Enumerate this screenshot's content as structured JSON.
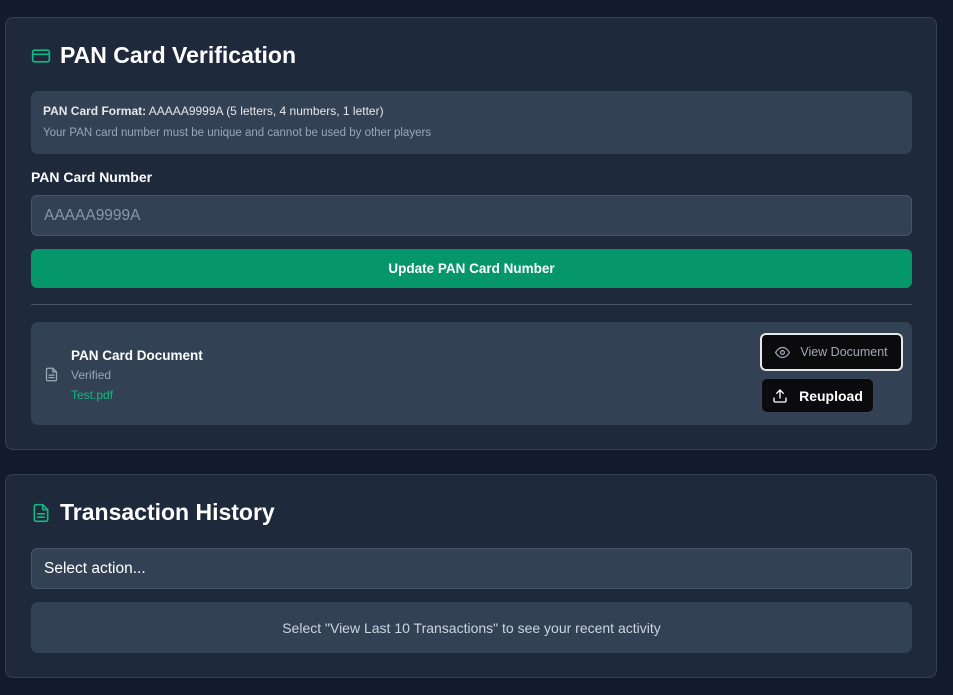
{
  "pan_section": {
    "title": "PAN Card Verification",
    "title_icon": "credit-card-icon",
    "info": {
      "format_label": "PAN Card Format:",
      "format_value": " AAAAA9999A (5 letters, 4 numbers, 1 letter)",
      "note": "Your PAN card number must be unique and cannot be used by other players"
    },
    "field_label": "PAN Card Number",
    "input_value": "",
    "input_placeholder": "AAAAA9999A",
    "update_button": "Update PAN Card Number",
    "document": {
      "icon": "file-icon",
      "name": "PAN Card Document",
      "status": "Verified",
      "file": "Test.pdf",
      "view_button": "View Document",
      "view_icon": "eye-icon",
      "reupload_button": "Reupload",
      "reupload_icon": "upload-icon"
    }
  },
  "transaction_section": {
    "title": "Transaction History",
    "title_icon": "file-text-icon",
    "select_value": "Select action...",
    "empty_message": "Select \"View Last 10 Transactions\" to see your recent activity"
  },
  "colors": {
    "background": "#121a2b",
    "card": "#1e293b",
    "panel": "#334155",
    "accent": "#059669",
    "accent_text": "#10b981"
  }
}
